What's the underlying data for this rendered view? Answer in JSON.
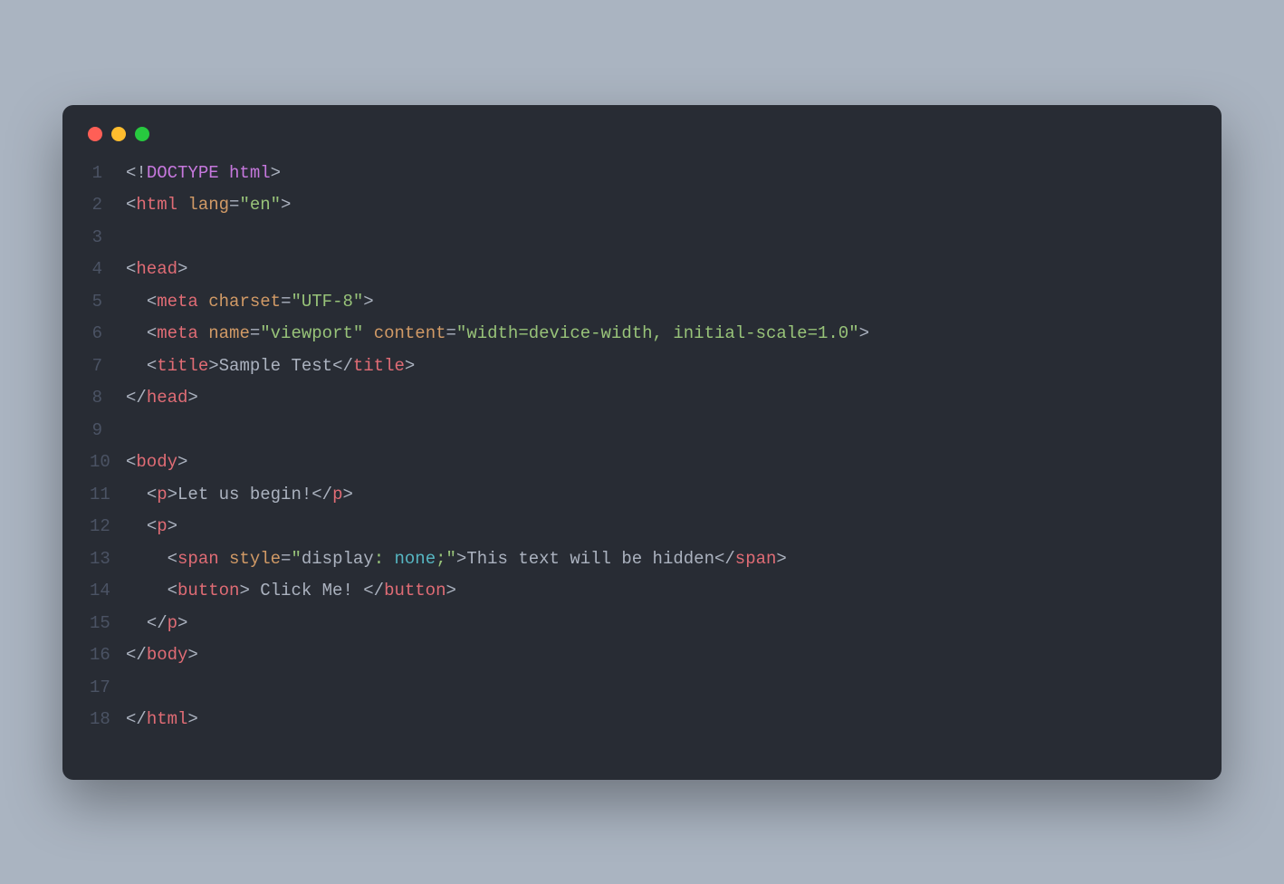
{
  "window": {
    "controls": {
      "close": "close",
      "minimize": "minimize",
      "maximize": "maximize"
    }
  },
  "code": {
    "lines": [
      {
        "n": "1",
        "tokens": [
          [
            "punct",
            "<!"
          ],
          [
            "doctype",
            "DOCTYPE html"
          ],
          [
            "punct",
            ">"
          ]
        ]
      },
      {
        "n": "2",
        "tokens": [
          [
            "punct",
            "<"
          ],
          [
            "tag",
            "html"
          ],
          [
            "text",
            " "
          ],
          [
            "attr",
            "lang"
          ],
          [
            "punct",
            "="
          ],
          [
            "string",
            "\"en\""
          ],
          [
            "punct",
            ">"
          ]
        ]
      },
      {
        "n": "3",
        "tokens": []
      },
      {
        "n": "4",
        "tokens": [
          [
            "punct",
            "<"
          ],
          [
            "tag",
            "head"
          ],
          [
            "punct",
            ">"
          ]
        ]
      },
      {
        "n": "5",
        "tokens": [
          [
            "text",
            "  "
          ],
          [
            "punct",
            "<"
          ],
          [
            "tag",
            "meta"
          ],
          [
            "text",
            " "
          ],
          [
            "attr",
            "charset"
          ],
          [
            "punct",
            "="
          ],
          [
            "string",
            "\"UTF-8\""
          ],
          [
            "punct",
            ">"
          ]
        ]
      },
      {
        "n": "6",
        "tokens": [
          [
            "text",
            "  "
          ],
          [
            "punct",
            "<"
          ],
          [
            "tag",
            "meta"
          ],
          [
            "text",
            " "
          ],
          [
            "attr",
            "name"
          ],
          [
            "punct",
            "="
          ],
          [
            "string",
            "\"viewport\""
          ],
          [
            "text",
            " "
          ],
          [
            "attr",
            "content"
          ],
          [
            "punct",
            "="
          ],
          [
            "string",
            "\"width=device-width, initial-scale=1.0\""
          ],
          [
            "punct",
            ">"
          ]
        ]
      },
      {
        "n": "7",
        "tokens": [
          [
            "text",
            "  "
          ],
          [
            "punct",
            "<"
          ],
          [
            "tag",
            "title"
          ],
          [
            "punct",
            ">"
          ],
          [
            "text",
            "Sample Test"
          ],
          [
            "punct",
            "</"
          ],
          [
            "tag",
            "title"
          ],
          [
            "punct",
            ">"
          ]
        ]
      },
      {
        "n": "8",
        "tokens": [
          [
            "punct",
            "</"
          ],
          [
            "tag",
            "head"
          ],
          [
            "punct",
            ">"
          ]
        ]
      },
      {
        "n": "9",
        "tokens": []
      },
      {
        "n": "10",
        "tokens": [
          [
            "punct",
            "<"
          ],
          [
            "tag",
            "body"
          ],
          [
            "punct",
            ">"
          ]
        ]
      },
      {
        "n": "11",
        "tokens": [
          [
            "text",
            "  "
          ],
          [
            "punct",
            "<"
          ],
          [
            "tag",
            "p"
          ],
          [
            "punct",
            ">"
          ],
          [
            "text",
            "Let us begin!"
          ],
          [
            "punct",
            "</"
          ],
          [
            "tag",
            "p"
          ],
          [
            "punct",
            ">"
          ]
        ]
      },
      {
        "n": "12",
        "tokens": [
          [
            "text",
            "  "
          ],
          [
            "punct",
            "<"
          ],
          [
            "tag",
            "p"
          ],
          [
            "punct",
            ">"
          ]
        ]
      },
      {
        "n": "13",
        "tokens": [
          [
            "text",
            "    "
          ],
          [
            "punct",
            "<"
          ],
          [
            "tag",
            "span"
          ],
          [
            "text",
            " "
          ],
          [
            "attr",
            "style"
          ],
          [
            "punct",
            "="
          ],
          [
            "string",
            "\""
          ],
          [
            "cssprop",
            "display"
          ],
          [
            "string",
            ": "
          ],
          [
            "cssval",
            "none"
          ],
          [
            "string",
            ";\""
          ],
          [
            "punct",
            ">"
          ],
          [
            "text",
            "This text will be hidden"
          ],
          [
            "punct",
            "</"
          ],
          [
            "tag",
            "span"
          ],
          [
            "punct",
            ">"
          ]
        ]
      },
      {
        "n": "14",
        "tokens": [
          [
            "text",
            "    "
          ],
          [
            "punct",
            "<"
          ],
          [
            "tag",
            "button"
          ],
          [
            "punct",
            ">"
          ],
          [
            "text",
            " Click Me! "
          ],
          [
            "punct",
            "</"
          ],
          [
            "tag",
            "button"
          ],
          [
            "punct",
            ">"
          ]
        ]
      },
      {
        "n": "15",
        "tokens": [
          [
            "text",
            "  "
          ],
          [
            "punct",
            "</"
          ],
          [
            "tag",
            "p"
          ],
          [
            "punct",
            ">"
          ]
        ]
      },
      {
        "n": "16",
        "tokens": [
          [
            "punct",
            "</"
          ],
          [
            "tag",
            "body"
          ],
          [
            "punct",
            ">"
          ]
        ]
      },
      {
        "n": "17",
        "tokens": []
      },
      {
        "n": "18",
        "tokens": [
          [
            "punct",
            "</"
          ],
          [
            "tag",
            "html"
          ],
          [
            "punct",
            ">"
          ]
        ]
      }
    ]
  }
}
